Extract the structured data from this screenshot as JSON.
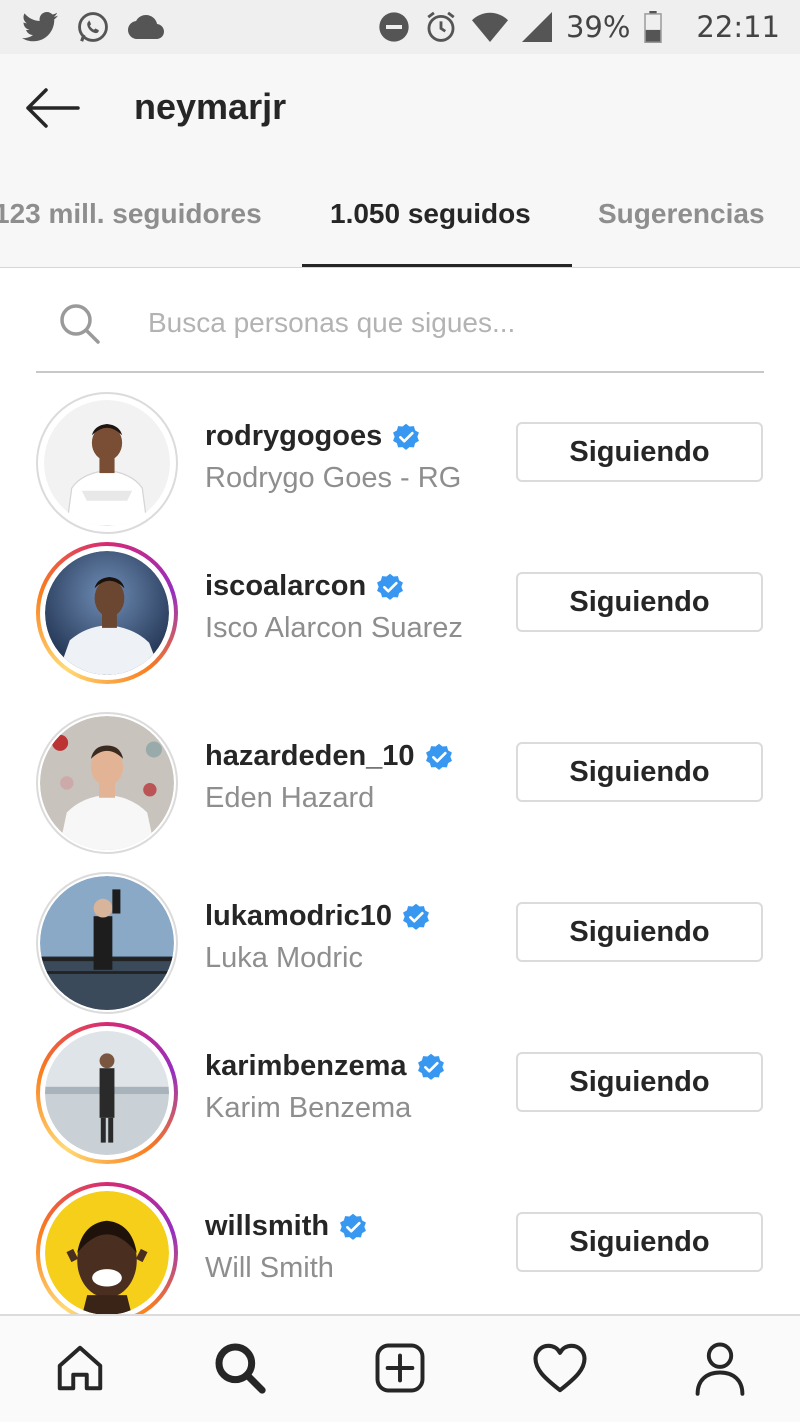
{
  "status_bar": {
    "battery": "39%",
    "time": "22:11",
    "left_icons": [
      "twitter-icon",
      "whatsapp-icon",
      "cloud-icon"
    ],
    "right_icons": [
      "dnd-icon",
      "alarm-icon",
      "wifi-icon",
      "signal-icon",
      "battery-icon"
    ]
  },
  "header": {
    "title": "neymarjr",
    "back_icon": "arrow-left-icon"
  },
  "tabs": [
    {
      "label": "123 mill. seguidores",
      "active": false
    },
    {
      "label": "1.050 seguidos",
      "active": true
    },
    {
      "label": "Sugerencias",
      "active": false
    }
  ],
  "search": {
    "placeholder": "Busca personas que sigues..."
  },
  "following": [
    {
      "username": "rodrygogoes",
      "full_name": "Rodrygo Goes - RG",
      "verified": true,
      "button": "Siguiendo"
    },
    {
      "username": "iscoalarcon",
      "full_name": "Isco Alarcon Suarez",
      "verified": true,
      "button": "Siguiendo"
    },
    {
      "username": "hazardeden_10",
      "full_name": "Eden Hazard",
      "verified": true,
      "button": "Siguiendo"
    },
    {
      "username": "lukamodric10",
      "full_name": "Luka Modric",
      "verified": true,
      "button": "Siguiendo"
    },
    {
      "username": "karimbenzema",
      "full_name": "Karim Benzema",
      "verified": true,
      "button": "Siguiendo"
    },
    {
      "username": "willsmith",
      "full_name": "Will Smith",
      "verified": true,
      "button": "Siguiendo"
    }
  ],
  "colors": {
    "verified_blue": "#3897f0",
    "text_primary": "#262626",
    "text_secondary": "#8e8e8e"
  },
  "bottom_nav": [
    "home-icon",
    "search-icon",
    "add-post-icon",
    "heart-icon",
    "profile-icon"
  ]
}
